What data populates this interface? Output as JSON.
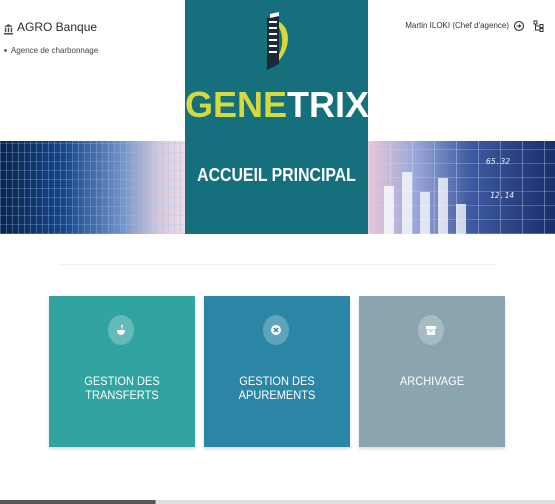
{
  "header": {
    "brand_name": "AGRO Banque",
    "agency": "Agence de charbonnage",
    "user": "Martin ILOKI (Chef d'agence)",
    "icons": [
      "bank-icon",
      "logout-icon",
      "sitemap-icon"
    ]
  },
  "hero": {
    "logo_part1": "GENE",
    "logo_part2": "TRIX",
    "page_title": "ACCUEIL PRINCIPAL",
    "colors": {
      "panel": "#156f7d",
      "logo_accent": "#d5d93c"
    }
  },
  "banner": {
    "numbers": [
      "65.32",
      "12.14"
    ]
  },
  "cards": [
    {
      "label": "GESTION DES TRANSFERTS",
      "icon": "mortar-pestle-icon",
      "color": "#31a3a0"
    },
    {
      "label": "GESTION DES APUREMENTS",
      "icon": "cancel-circle-icon",
      "color": "#2b86a6"
    },
    {
      "label": "ARCHIVAGE",
      "icon": "archive-box-icon",
      "color": "#8aa4b0"
    }
  ]
}
